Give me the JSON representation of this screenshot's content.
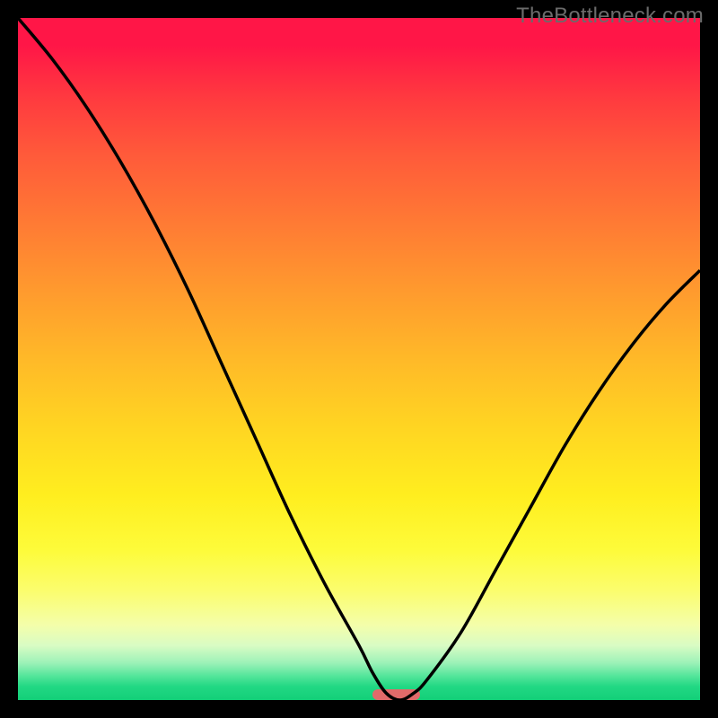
{
  "watermark": "TheBottleneck.com",
  "chart_data": {
    "type": "line",
    "title": "",
    "xlabel": "",
    "ylabel": "",
    "xlim": [
      0,
      100
    ],
    "ylim": [
      0,
      100
    ],
    "grid": false,
    "legend": false,
    "series": [
      {
        "name": "bottleneck-curve",
        "x": [
          0,
          5,
          10,
          15,
          20,
          25,
          30,
          35,
          40,
          45,
          50,
          52,
          54,
          56,
          58,
          60,
          65,
          70,
          75,
          80,
          85,
          90,
          95,
          100
        ],
        "y": [
          100,
          94,
          87,
          79,
          70,
          60,
          49,
          38,
          27,
          17,
          8,
          4,
          1,
          0,
          1,
          3,
          10,
          19,
          28,
          37,
          45,
          52,
          58,
          63
        ]
      }
    ],
    "marker": {
      "name": "sweet-spot",
      "x_start": 52,
      "x_end": 59,
      "y": 0,
      "color": "#e16a6a"
    },
    "background_gradient": {
      "top_color": "#ff1647",
      "mid_color": "#ffee1f",
      "bottom_color": "#12cf78"
    }
  }
}
